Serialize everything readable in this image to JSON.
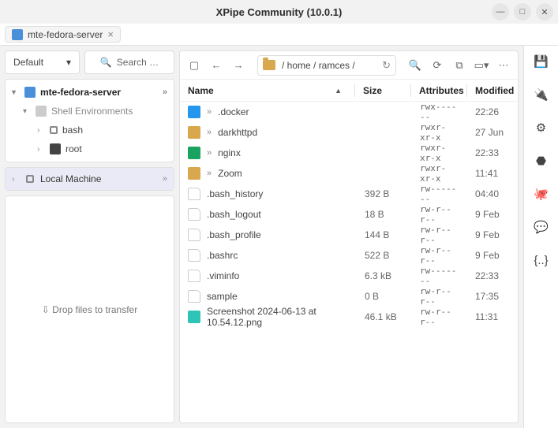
{
  "title": "XPipe Community (10.0.1)",
  "tab": {
    "label": "mte-fedora-server"
  },
  "left": {
    "default_label": "Default",
    "search_placeholder": "Search …",
    "tree": {
      "host": "mte-fedora-server",
      "shell_env": "Shell Environments",
      "bash": "bash",
      "root": "root"
    },
    "local_machine": "Local Machine",
    "drop_text": "⇩ Drop files to transfer"
  },
  "path": "/ home / ramces /",
  "columns": {
    "name": "Name",
    "size": "Size",
    "attr": "Attributes",
    "mod": "Modified"
  },
  "files": [
    {
      "icon": "folder-docker",
      "name": ".docker",
      "size": "",
      "attr": "rwx------",
      "mod": "22:26",
      "dir": true
    },
    {
      "icon": "folder",
      "name": "darkhttpd",
      "size": "",
      "attr": "rwxr-xr-x",
      "mod": "27 Jun",
      "dir": true
    },
    {
      "icon": "folder-nginx",
      "name": "nginx",
      "size": "",
      "attr": "rwxr-xr-x",
      "mod": "22:33",
      "dir": true
    },
    {
      "icon": "folder",
      "name": "Zoom",
      "size": "",
      "attr": "rwxr-xr-x",
      "mod": "11:41",
      "dir": true
    },
    {
      "icon": "file",
      "name": ".bash_history",
      "size": "392 B",
      "attr": "rw-------",
      "mod": "04:40",
      "dir": false
    },
    {
      "icon": "file",
      "name": ".bash_logout",
      "size": "18 B",
      "attr": "rw-r--r--",
      "mod": "9 Feb",
      "dir": false
    },
    {
      "icon": "file",
      "name": ".bash_profile",
      "size": "144 B",
      "attr": "rw-r--r--",
      "mod": "9 Feb",
      "dir": false
    },
    {
      "icon": "file",
      "name": ".bashrc",
      "size": "522 B",
      "attr": "rw-r--r--",
      "mod": "9 Feb",
      "dir": false
    },
    {
      "icon": "file",
      "name": ".viminfo",
      "size": "6.3 kB",
      "attr": "rw-------",
      "mod": "22:33",
      "dir": false
    },
    {
      "icon": "file",
      "name": "sample",
      "size": "0 B",
      "attr": "rw-r--r--",
      "mod": "17:35",
      "dir": false
    },
    {
      "icon": "img",
      "name": "Screenshot 2024-06-13 at 10.54.12.png",
      "size": "46.1 kB",
      "attr": "rw-r--r--",
      "mod": "11:31",
      "dir": false
    }
  ]
}
